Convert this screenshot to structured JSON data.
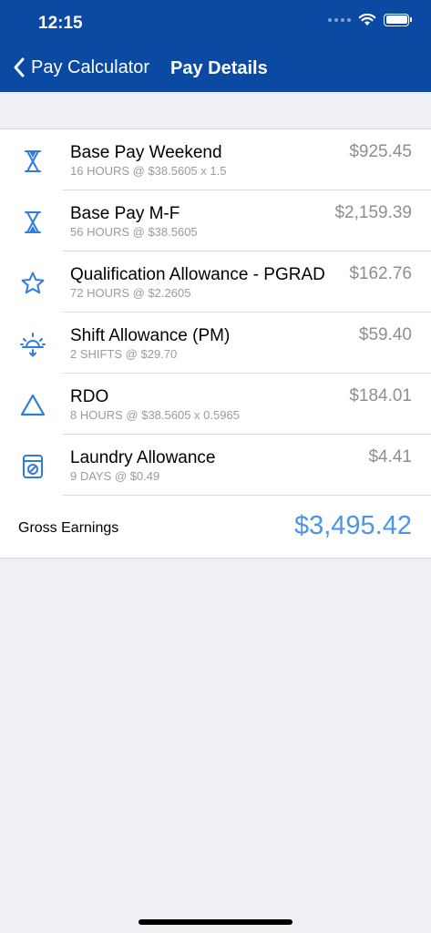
{
  "status": {
    "time": "12:15"
  },
  "nav": {
    "back_label": "Pay Calculator",
    "title": "Pay Details"
  },
  "items": [
    {
      "title": "Base Pay Weekend",
      "detail": "16 HOURS @ $38.5605  x 1.5",
      "amount": "$925.45",
      "icon": "hourglass-icon"
    },
    {
      "title": "Base Pay M-F",
      "detail": "56 HOURS @ $38.5605",
      "amount": "$2,159.39",
      "icon": "hourglass-icon"
    },
    {
      "title": "Qualification Allowance - PGRAD",
      "detail": "72 HOURS @ $2.2605",
      "amount": "$162.76",
      "icon": "star-icon"
    },
    {
      "title": "Shift Allowance (PM)",
      "detail": "2 SHIFTS @ $29.70",
      "amount": "$59.40",
      "icon": "sunset-icon"
    },
    {
      "title": "RDO",
      "detail": "8 HOURS @ $38.5605  x 0.5965",
      "amount": "$184.01",
      "icon": "triangle-icon"
    },
    {
      "title": "Laundry Allowance",
      "detail": "9 DAYS @ $0.49",
      "amount": "$4.41",
      "icon": "washing-machine-icon"
    }
  ],
  "total": {
    "label": "Gross Earnings",
    "value": "$3,495.42"
  },
  "colors": {
    "header": "#0b4aa2",
    "accent": "#2f7be0",
    "total": "#4a95e8"
  }
}
